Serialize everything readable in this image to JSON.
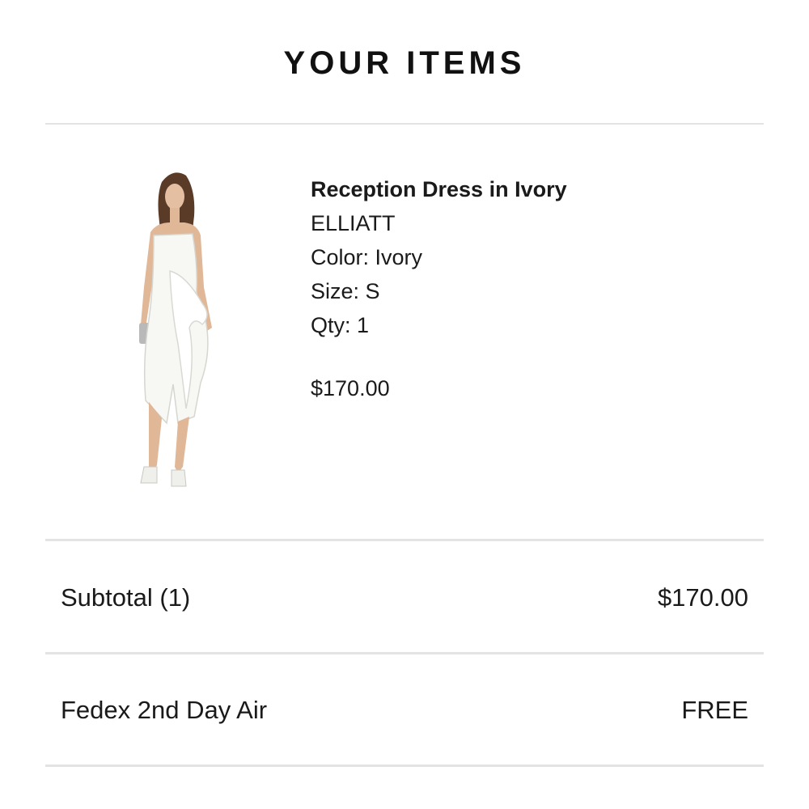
{
  "header": {
    "title": "YOUR ITEMS"
  },
  "item": {
    "image_icon": "product-photo-icon",
    "name": "Reception Dress in Ivory",
    "brand": "ELLIATT",
    "color": "Color: Ivory",
    "size": "Size: S",
    "qty": "Qty: 1",
    "price": "$170.00"
  },
  "summary": {
    "subtotal_label": "Subtotal (1)",
    "subtotal_value": "$170.00",
    "shipping_label": "Fedex 2nd Day Air",
    "shipping_value": "FREE"
  }
}
